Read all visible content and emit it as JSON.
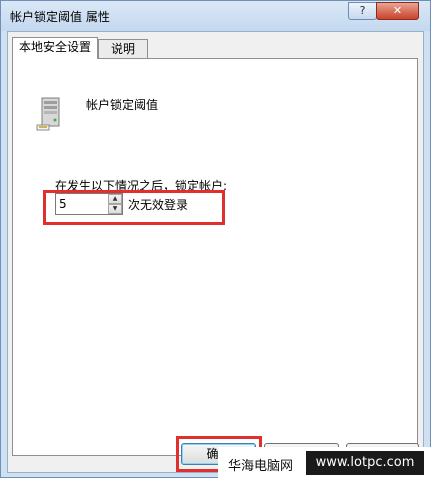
{
  "window": {
    "title": "帐户锁定阈值 属性",
    "help_button": "?",
    "close_button": "✕"
  },
  "tabs": [
    {
      "label": "本地安全设置",
      "active": true
    },
    {
      "label": "说明",
      "active": false
    }
  ],
  "policy": {
    "name": "帐户锁定阈值",
    "icon": "server-icon",
    "description": "在发生以下情况之后，锁定帐户:",
    "threshold_value": "5",
    "unit_label": "次无效登录"
  },
  "buttons": {
    "ok": "确定",
    "cancel": "",
    "apply": ""
  },
  "highlight_color": "#e0302e",
  "watermark": {
    "text": "华海电脑网",
    "url": "www.lotpc.com"
  }
}
